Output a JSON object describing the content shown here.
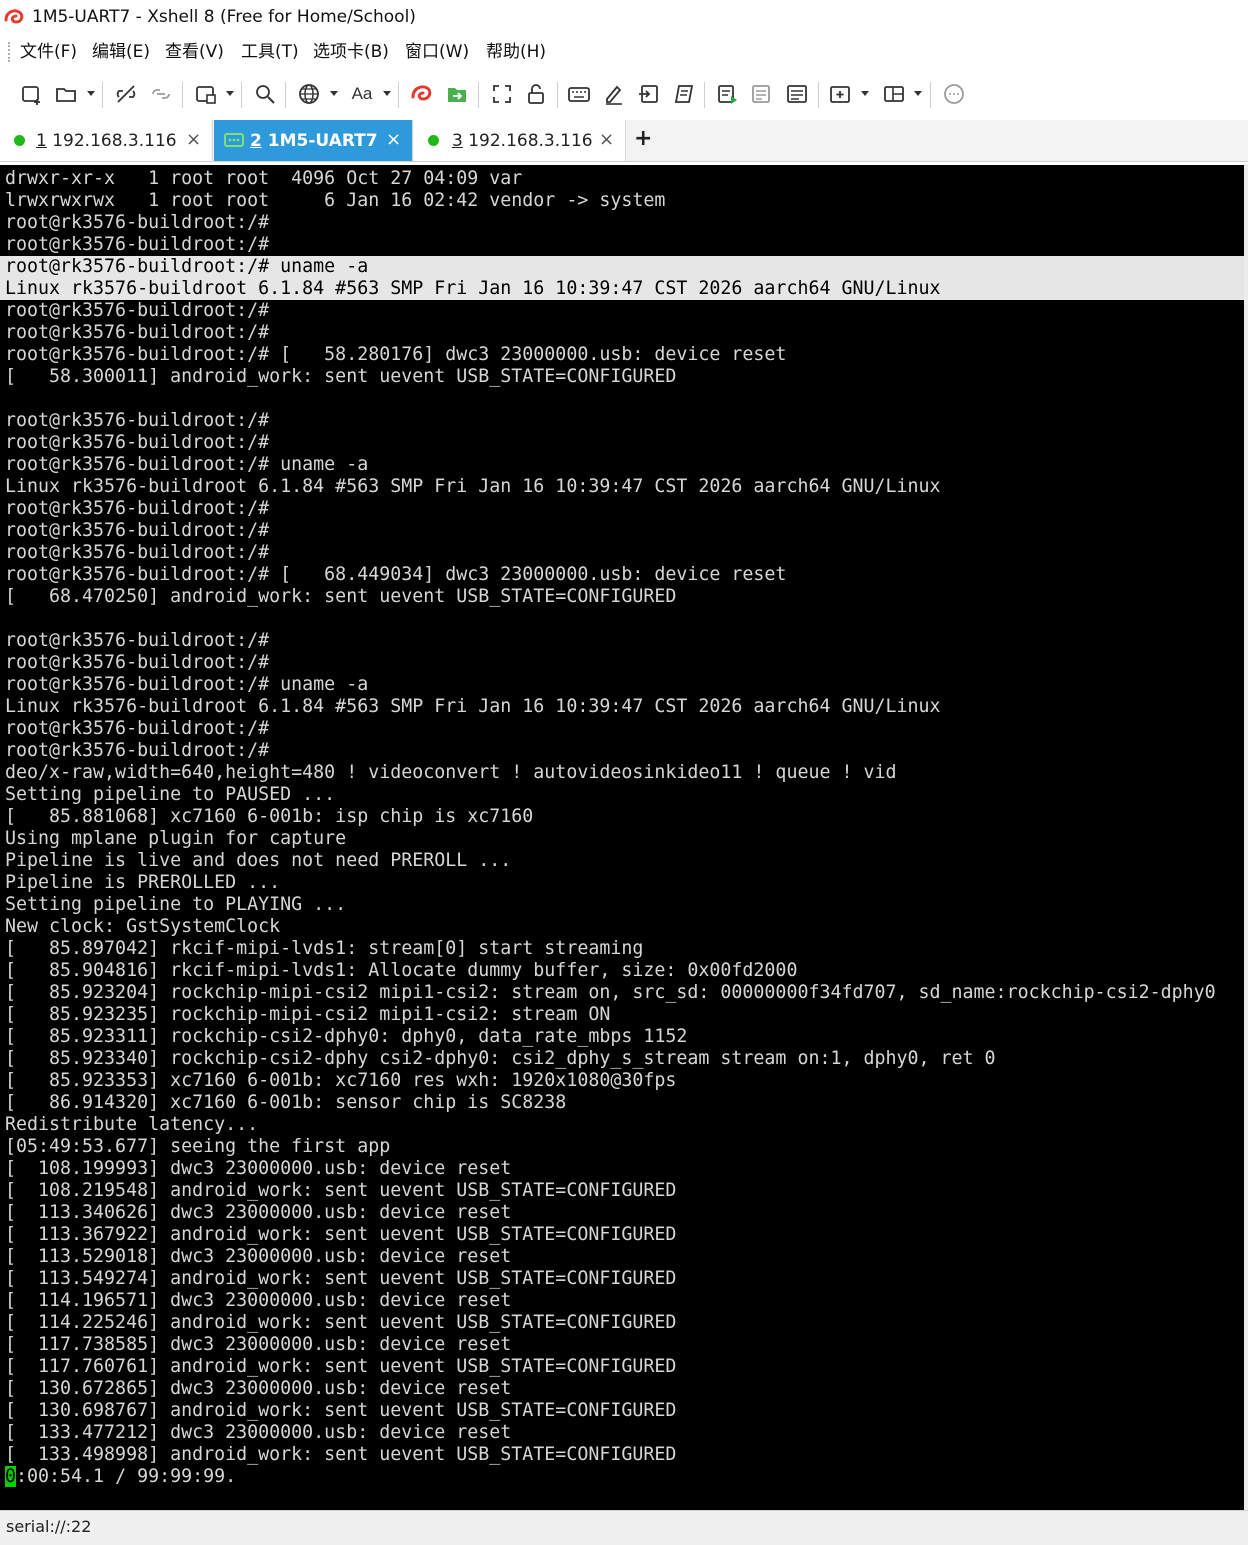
{
  "window": {
    "title": "1M5-UART7 - Xshell 8 (Free for Home/School)"
  },
  "menu": [
    "文件(F)",
    "编辑(E)",
    "查看(V)",
    "工具(T)",
    "选项卡(B)",
    "窗口(W)",
    "帮助(H)"
  ],
  "toolbar": {
    "font_label": "Aa"
  },
  "tabs": [
    {
      "num": "1",
      "label": " 192.168.3.116",
      "status": "connected",
      "close": "×"
    },
    {
      "num": "2",
      "label": " 1M5-UART7",
      "status": "serial-active",
      "close": "×"
    },
    {
      "num": "3",
      "label": " 192.168.3.116",
      "status": "connected",
      "close": "×"
    }
  ],
  "new_tab": "+",
  "terminal": {
    "lines": [
      "drwxr-xr-x   1 root root  4096 Oct 27 04:09 var",
      "lrwxrwxrwx   1 root root     6 Jan 16 02:42 vendor -> system",
      "root@rk3576-buildroot:/#",
      "root@rk3576-buildroot:/#",
      "root@rk3576-buildroot:/# uname -a",
      "Linux rk3576-buildroot 6.1.84 #563 SMP Fri Jan 16 10:39:47 CST 2026 aarch64 GNU/Linux",
      "root@rk3576-buildroot:/#",
      "root@rk3576-buildroot:/#",
      "root@rk3576-buildroot:/# [   58.280176] dwc3 23000000.usb: device reset",
      "[   58.300011] android_work: sent uevent USB_STATE=CONFIGURED",
      "",
      "root@rk3576-buildroot:/#",
      "root@rk3576-buildroot:/#",
      "root@rk3576-buildroot:/# uname -a",
      "Linux rk3576-buildroot 6.1.84 #563 SMP Fri Jan 16 10:39:47 CST 2026 aarch64 GNU/Linux",
      "root@rk3576-buildroot:/#",
      "root@rk3576-buildroot:/#",
      "root@rk3576-buildroot:/#",
      "root@rk3576-buildroot:/# [   68.449034] dwc3 23000000.usb: device reset",
      "[   68.470250] android_work: sent uevent USB_STATE=CONFIGURED",
      "",
      "root@rk3576-buildroot:/#",
      "root@rk3576-buildroot:/#",
      "root@rk3576-buildroot:/# uname -a",
      "Linux rk3576-buildroot 6.1.84 #563 SMP Fri Jan 16 10:39:47 CST 2026 aarch64 GNU/Linux",
      "root@rk3576-buildroot:/#",
      "root@rk3576-buildroot:/#",
      "deo/x-raw,width=640,height=480 ! videoconvert ! autovideosinkideo11 ! queue ! vid",
      "Setting pipeline to PAUSED ...",
      "[   85.881068] xc7160 6-001b: isp chip is xc7160",
      "Using mplane plugin for capture",
      "Pipeline is live and does not need PREROLL ...",
      "Pipeline is PREROLLED ...",
      "Setting pipeline to PLAYING ...",
      "New clock: GstSystemClock",
      "[   85.897042] rkcif-mipi-lvds1: stream[0] start streaming",
      "[   85.904816] rkcif-mipi-lvds1: Allocate dummy buffer, size: 0x00fd2000",
      "[   85.923204] rockchip-mipi-csi2 mipi1-csi2: stream on, src_sd: 00000000f34fd707, sd_name:rockchip-csi2-dphy0",
      "[   85.923235] rockchip-mipi-csi2 mipi1-csi2: stream ON",
      "[   85.923311] rockchip-csi2-dphy0: dphy0, data_rate_mbps 1152",
      "[   85.923340] rockchip-csi2-dphy csi2-dphy0: csi2_dphy_s_stream stream on:1, dphy0, ret 0",
      "[   85.923353] xc7160 6-001b: xc7160 res wxh: 1920x1080@30fps",
      "[   86.914320] xc7160 6-001b: sensor chip is SC8238",
      "Redistribute latency...",
      "[05:49:53.677] seeing the first app",
      "[  108.199993] dwc3 23000000.usb: device reset",
      "[  108.219548] android_work: sent uevent USB_STATE=CONFIGURED",
      "[  113.340626] dwc3 23000000.usb: device reset",
      "[  113.367922] android_work: sent uevent USB_STATE=CONFIGURED",
      "[  113.529018] dwc3 23000000.usb: device reset",
      "[  113.549274] android_work: sent uevent USB_STATE=CONFIGURED",
      "[  114.196571] dwc3 23000000.usb: device reset",
      "[  114.225246] android_work: sent uevent USB_STATE=CONFIGURED",
      "[  117.738585] dwc3 23000000.usb: device reset",
      "[  117.760761] android_work: sent uevent USB_STATE=CONFIGURED",
      "[  130.672865] dwc3 23000000.usb: device reset",
      "[  130.698767] android_work: sent uevent USB_STATE=CONFIGURED",
      "[  133.477212] dwc3 23000000.usb: device reset",
      "[  133.498998] android_work: sent uevent USB_STATE=CONFIGURED"
    ],
    "highlighted_lines": [
      4,
      5
    ],
    "last_line": {
      "cursor_char": "0",
      "rest": ":00:54.1 / 99:99:99."
    }
  },
  "status": {
    "connection": "serial://:22"
  },
  "colors": {
    "accent_tab": "#2f9adb",
    "connected_dot": "#1fb816",
    "terminal_bg": "#000000",
    "terminal_fg": "#d6d6d6",
    "cursor": "#00d000"
  }
}
